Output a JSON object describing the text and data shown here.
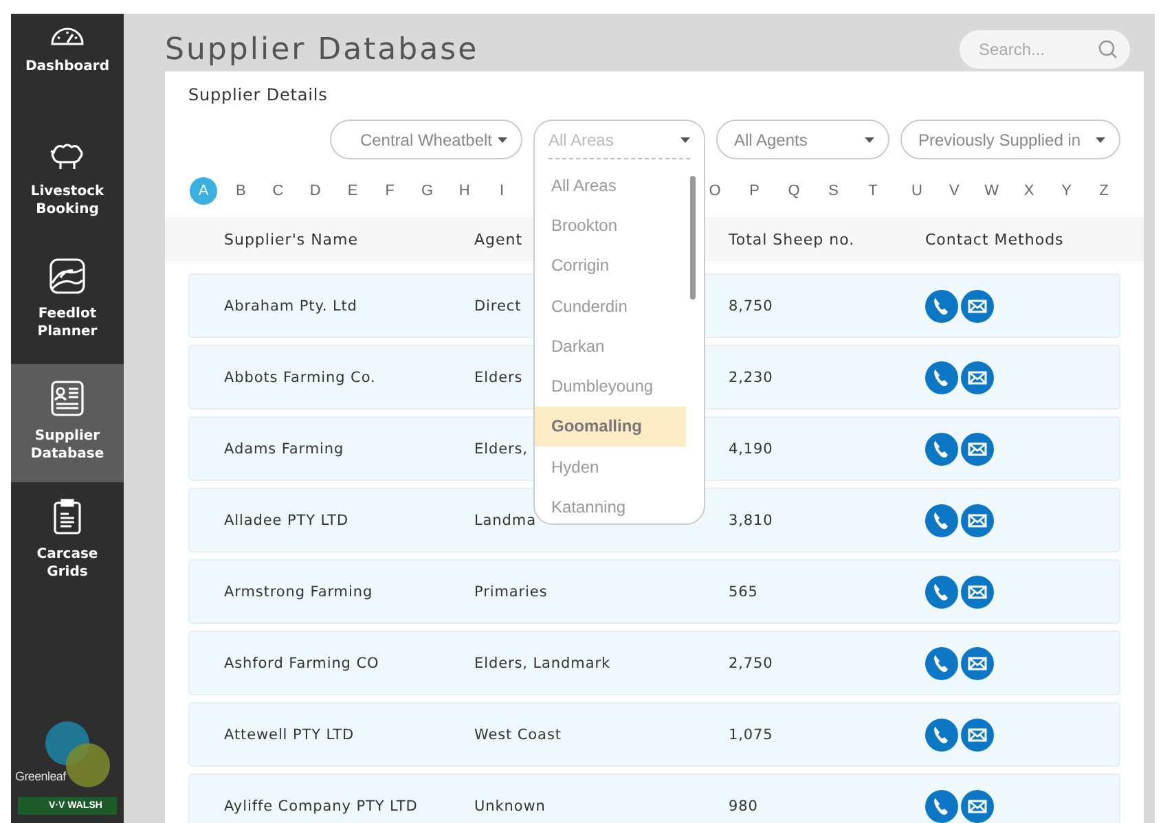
{
  "sidebar": {
    "items": [
      {
        "label": "Dashboard",
        "kind": "gauge",
        "selected": false
      },
      {
        "label": "Livestock Booking",
        "kind": "sheep",
        "selected": false
      },
      {
        "label": "Feedlot Planner",
        "kind": "landscape",
        "selected": false
      },
      {
        "label": "Supplier Database",
        "kind": "card",
        "selected": true
      },
      {
        "label": "Carcase Grids",
        "kind": "clipboard",
        "selected": false
      }
    ],
    "logos": [
      "Greenleaf",
      "V·V WALSH"
    ]
  },
  "page": {
    "title": "Supplier Database",
    "search": {
      "placeholder": "Search..."
    }
  },
  "card": {
    "title": "Supplier Details",
    "filters": [
      {
        "label": "Central Wheatbelt",
        "open": false
      },
      {
        "placeholder": "All Areas",
        "open": true,
        "options": [
          {
            "label": "All Areas",
            "selected": false
          },
          {
            "label": "Brookton",
            "selected": false
          },
          {
            "label": "Corrigin",
            "selected": false
          },
          {
            "label": "Cunderdin",
            "selected": false
          },
          {
            "label": "Darkan",
            "selected": false
          },
          {
            "label": "Dumbleyoung",
            "selected": false
          },
          {
            "label": "Goomalling",
            "selected": true
          },
          {
            "label": "Hyden",
            "selected": false
          },
          {
            "label": "Katanning",
            "selected": false
          }
        ]
      },
      {
        "label": "All Agents",
        "open": false
      },
      {
        "label": "Previously Supplied in",
        "open": false
      }
    ],
    "alphabet": {
      "groups": [
        [
          {
            "letter": "A",
            "selected": true
          },
          {
            "letter": "B",
            "selected": false
          },
          {
            "letter": "C",
            "selected": false
          },
          {
            "letter": "D",
            "selected": false
          },
          {
            "letter": "E",
            "selected": false
          },
          {
            "letter": "F",
            "selected": false
          },
          {
            "letter": "G",
            "selected": false
          },
          {
            "letter": "H",
            "selected": false
          },
          {
            "letter": "I",
            "selected": false
          }
        ],
        [
          {
            "letter": "O",
            "selected": false
          },
          {
            "letter": "P",
            "selected": false
          },
          {
            "letter": "Q",
            "selected": false
          },
          {
            "letter": "S",
            "selected": false
          },
          {
            "letter": "T",
            "selected": false
          }
        ],
        [
          {
            "letter": "U",
            "selected": false
          },
          {
            "letter": "V",
            "selected": false
          },
          {
            "letter": "W",
            "selected": false
          },
          {
            "letter": "X",
            "selected": false
          },
          {
            "letter": "Y",
            "selected": false
          },
          {
            "letter": "Z",
            "selected": false
          }
        ]
      ]
    },
    "table": {
      "columns": [
        "Supplier's Name",
        "Agent",
        "Total Sheep no.",
        "Contact Methods"
      ],
      "rows": [
        {
          "name": "Abraham Pty. Ltd",
          "agent": "Direct",
          "total": "8,750"
        },
        {
          "name": "Abbots Farming Co.",
          "agent": "Elders",
          "total": "2,230"
        },
        {
          "name": "Adams Farming",
          "agent": "Elders,",
          "total": "4,190"
        },
        {
          "name": "Alladee PTY LTD",
          "agent": "Landma",
          "total": "3,810"
        },
        {
          "name": "Armstrong Farming",
          "agent": "Primaries",
          "total": "565"
        },
        {
          "name": "Ashford Farming CO",
          "agent": "Elders, Landmark",
          "total": "2,750"
        },
        {
          "name": "Attewell PTY LTD",
          "agent": "West Coast",
          "total": "1,075"
        },
        {
          "name": "Ayliffe Company PTY LTD",
          "agent": "Unknown",
          "total": "980"
        }
      ]
    }
  }
}
